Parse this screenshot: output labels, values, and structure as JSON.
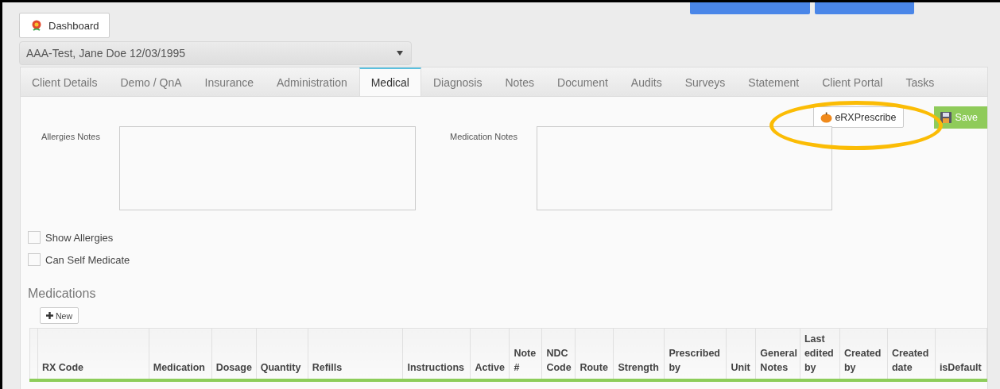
{
  "dashboard_button": {
    "label": "Dashboard"
  },
  "client_select": {
    "value": "AAA-Test, Jane Doe 12/03/1995"
  },
  "tabs": [
    {
      "label": "Client Details",
      "selected": false
    },
    {
      "label": "Demo / QnA",
      "selected": false
    },
    {
      "label": "Insurance",
      "selected": false
    },
    {
      "label": "Administration",
      "selected": false
    },
    {
      "label": "Medical",
      "selected": true
    },
    {
      "label": "Diagnosis",
      "selected": false
    },
    {
      "label": "Notes",
      "selected": false
    },
    {
      "label": "Document",
      "selected": false
    },
    {
      "label": "Audits",
      "selected": false
    },
    {
      "label": "Surveys",
      "selected": false
    },
    {
      "label": "Statement",
      "selected": false
    },
    {
      "label": "Client Portal",
      "selected": false
    },
    {
      "label": "Tasks",
      "selected": false
    }
  ],
  "actions": {
    "erx_button": "eRXPrescribe",
    "save_button": "Save"
  },
  "notes_fields": [
    {
      "label": "Allergies Notes"
    },
    {
      "label": "Medication Notes"
    }
  ],
  "checkboxes": [
    {
      "label": "Show Allergies",
      "checked": false
    },
    {
      "label": "Can Self Medicate",
      "checked": false
    }
  ],
  "medications": {
    "title": "Medications",
    "new_button": "New",
    "columns": [
      "RX Code",
      "Medication",
      "Dosage",
      "Quantity",
      "Refills",
      "Instructions",
      "Active",
      "Note #",
      "NDC Code",
      "Route",
      "Strength",
      "Prescribed by",
      "Unit",
      "General Notes",
      "Last edited by",
      "Created by",
      "Created date",
      "isDefault"
    ]
  }
}
